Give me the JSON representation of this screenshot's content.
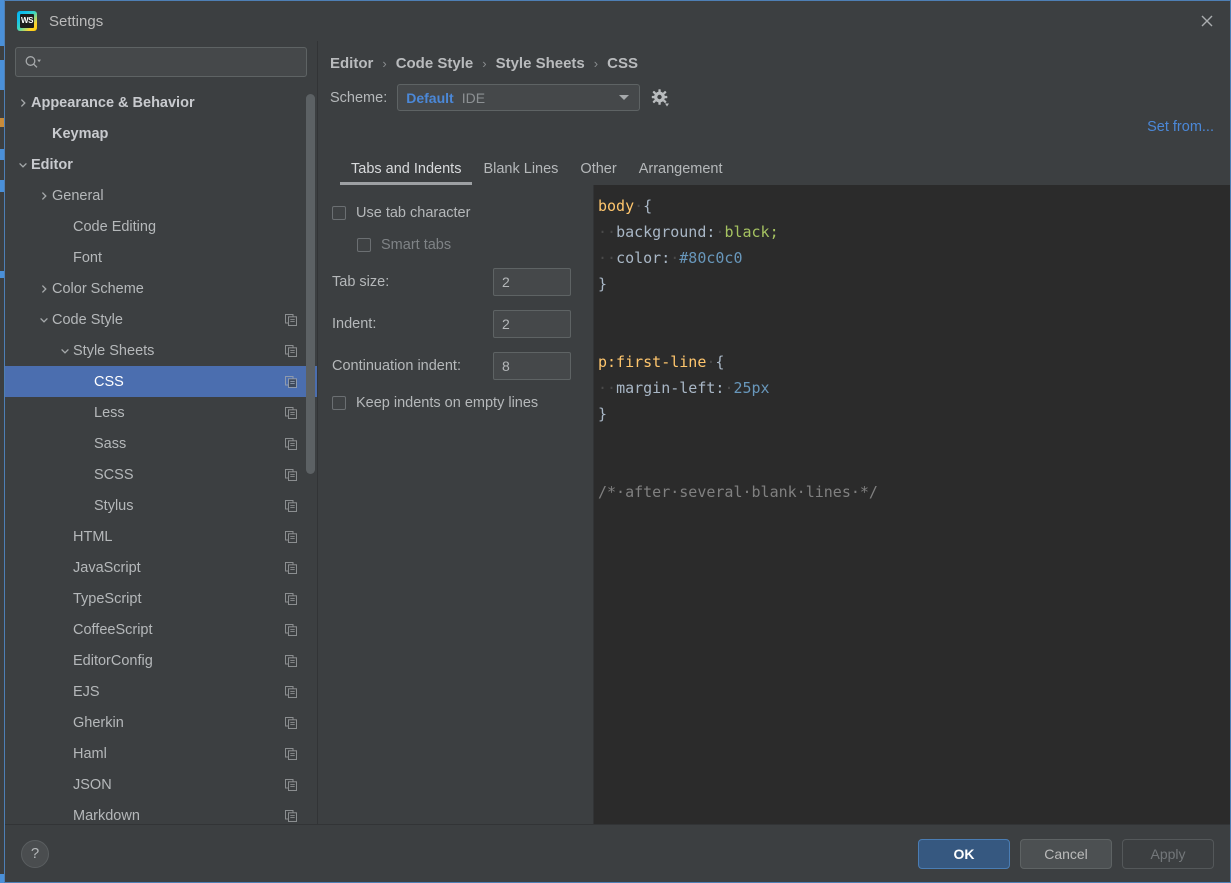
{
  "window": {
    "title": "Settings",
    "logo_icon": "webstorm-logo-icon",
    "logo_text": "WS",
    "close_icon": "close-icon"
  },
  "search": {
    "placeholder": "",
    "value": "",
    "icon": "search-icon"
  },
  "sidebar": {
    "items": [
      {
        "label": "Appearance & Behavior",
        "indent": 0,
        "arrow": "chevron-right",
        "bold": true,
        "copy": false,
        "selected": false
      },
      {
        "label": "Keymap",
        "indent": 1,
        "arrow": "none",
        "bold": true,
        "copy": false,
        "selected": false
      },
      {
        "label": "Editor",
        "indent": 0,
        "arrow": "chevron-down",
        "bold": true,
        "copy": false,
        "selected": false
      },
      {
        "label": "General",
        "indent": 1,
        "arrow": "chevron-right",
        "bold": false,
        "copy": false,
        "selected": false
      },
      {
        "label": "Code Editing",
        "indent": 2,
        "arrow": "none",
        "bold": false,
        "copy": false,
        "selected": false
      },
      {
        "label": "Font",
        "indent": 2,
        "arrow": "none",
        "bold": false,
        "copy": false,
        "selected": false
      },
      {
        "label": "Color Scheme",
        "indent": 1,
        "arrow": "chevron-right",
        "bold": false,
        "copy": false,
        "selected": false
      },
      {
        "label": "Code Style",
        "indent": 1,
        "arrow": "chevron-down",
        "bold": false,
        "copy": true,
        "selected": false
      },
      {
        "label": "Style Sheets",
        "indent": 2,
        "arrow": "chevron-down",
        "bold": false,
        "copy": true,
        "selected": false
      },
      {
        "label": "CSS",
        "indent": 3,
        "arrow": "none",
        "bold": false,
        "copy": true,
        "selected": true
      },
      {
        "label": "Less",
        "indent": 3,
        "arrow": "none",
        "bold": false,
        "copy": true,
        "selected": false
      },
      {
        "label": "Sass",
        "indent": 3,
        "arrow": "none",
        "bold": false,
        "copy": true,
        "selected": false
      },
      {
        "label": "SCSS",
        "indent": 3,
        "arrow": "none",
        "bold": false,
        "copy": true,
        "selected": false
      },
      {
        "label": "Stylus",
        "indent": 3,
        "arrow": "none",
        "bold": false,
        "copy": true,
        "selected": false
      },
      {
        "label": "HTML",
        "indent": 2,
        "arrow": "none",
        "bold": false,
        "copy": true,
        "selected": false
      },
      {
        "label": "JavaScript",
        "indent": 2,
        "arrow": "none",
        "bold": false,
        "copy": true,
        "selected": false
      },
      {
        "label": "TypeScript",
        "indent": 2,
        "arrow": "none",
        "bold": false,
        "copy": true,
        "selected": false
      },
      {
        "label": "CoffeeScript",
        "indent": 2,
        "arrow": "none",
        "bold": false,
        "copy": true,
        "selected": false
      },
      {
        "label": "EditorConfig",
        "indent": 2,
        "arrow": "none",
        "bold": false,
        "copy": true,
        "selected": false
      },
      {
        "label": "EJS",
        "indent": 2,
        "arrow": "none",
        "bold": false,
        "copy": true,
        "selected": false
      },
      {
        "label": "Gherkin",
        "indent": 2,
        "arrow": "none",
        "bold": false,
        "copy": true,
        "selected": false
      },
      {
        "label": "Haml",
        "indent": 2,
        "arrow": "none",
        "bold": false,
        "copy": true,
        "selected": false
      },
      {
        "label": "JSON",
        "indent": 2,
        "arrow": "none",
        "bold": false,
        "copy": true,
        "selected": false
      },
      {
        "label": "Markdown",
        "indent": 2,
        "arrow": "none",
        "bold": false,
        "copy": true,
        "selected": false
      }
    ]
  },
  "breadcrumb": {
    "separator": "›",
    "crumbs": [
      "Editor",
      "Code Style",
      "Style Sheets",
      "CSS"
    ]
  },
  "scheme": {
    "label": "Scheme:",
    "value": "Default",
    "qualifier": "IDE",
    "dropdown_icon": "chevron-down-icon",
    "gear_icon": "gear-icon"
  },
  "set_from": {
    "label": "Set from..."
  },
  "tabs": [
    {
      "label": "Tabs and Indents",
      "active": true
    },
    {
      "label": "Blank Lines",
      "active": false
    },
    {
      "label": "Other",
      "active": false
    },
    {
      "label": "Arrangement",
      "active": false
    }
  ],
  "settings": {
    "use_tab_character": {
      "label": "Use tab character",
      "checked": false,
      "disabled": false
    },
    "smart_tabs": {
      "label": "Smart tabs",
      "checked": false,
      "disabled": true
    },
    "tab_size": {
      "label": "Tab size:",
      "value": "2"
    },
    "indent": {
      "label": "Indent:",
      "value": "2"
    },
    "continuation_indent": {
      "label": "Continuation indent:",
      "value": "8"
    },
    "keep_indents": {
      "label": "Keep indents on empty lines",
      "checked": false,
      "disabled": false
    }
  },
  "preview": {
    "lines": [
      [
        {
          "t": "body",
          "c": "t-sel"
        },
        {
          "t": "·",
          "c": "ws"
        },
        {
          "t": "{",
          "c": "t-punc"
        }
      ],
      [
        {
          "t": "··",
          "c": "ws"
        },
        {
          "t": "background:",
          "c": "t-prop"
        },
        {
          "t": "·",
          "c": "ws"
        },
        {
          "t": "black;",
          "c": "t-val-kw"
        }
      ],
      [
        {
          "t": "··",
          "c": "ws"
        },
        {
          "t": "color:",
          "c": "t-prop"
        },
        {
          "t": "·",
          "c": "ws"
        },
        {
          "t": "#80c0c0",
          "c": "t-val-num"
        }
      ],
      [
        {
          "t": "}",
          "c": "t-punc"
        }
      ],
      [],
      [],
      [
        {
          "t": "p:first-line",
          "c": "t-pseu"
        },
        {
          "t": "·",
          "c": "ws"
        },
        {
          "t": "{",
          "c": "t-punc"
        }
      ],
      [
        {
          "t": "··",
          "c": "ws"
        },
        {
          "t": "margin-left:",
          "c": "t-prop"
        },
        {
          "t": "·",
          "c": "ws"
        },
        {
          "t": "25px",
          "c": "t-val-num"
        }
      ],
      [
        {
          "t": "}",
          "c": "t-punc"
        }
      ],
      [],
      [],
      [
        {
          "t": "/*·after·several·blank·lines·*/",
          "c": "t-comment"
        }
      ]
    ]
  },
  "footer": {
    "help_label": "?",
    "buttons": [
      {
        "label": "OK",
        "style": "primary"
      },
      {
        "label": "Cancel",
        "style": "normal"
      },
      {
        "label": "Apply",
        "style": "disabled"
      }
    ]
  },
  "colors": {
    "dialog_bg": "#3c3f41",
    "selection_blue": "#4b6eaf",
    "link_blue": "#4b88d8",
    "primary_button": "#365880",
    "editor_bg": "#2b2b2b",
    "selector_yellow": "#ffc66d",
    "keyword_green": "#a5c261",
    "number_blue": "#6897bb",
    "comment_gray": "#808080",
    "border_accent": "#4e7fb5"
  }
}
